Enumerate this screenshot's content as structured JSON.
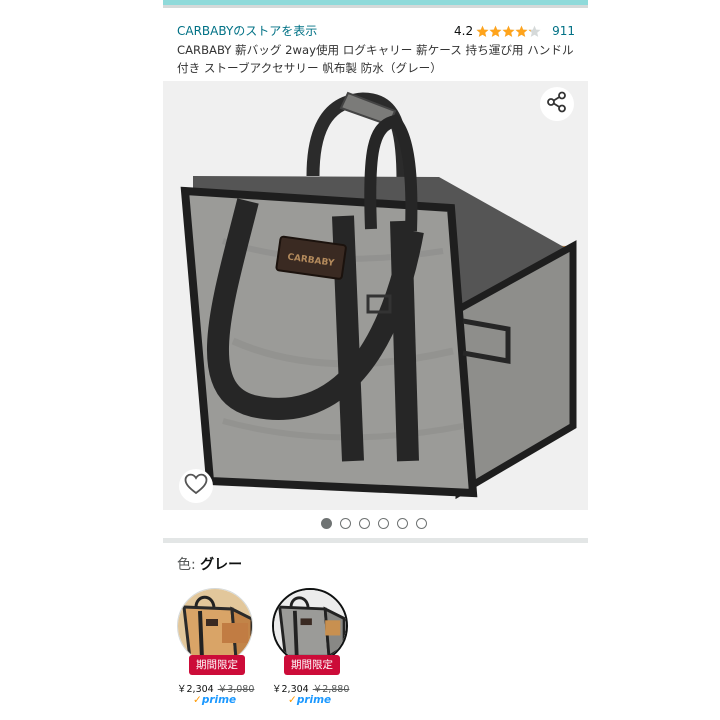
{
  "store": {
    "link_text": "CARBABYのストアを表示",
    "rating": "4.2",
    "stars_filled": 4.2,
    "stars_max": 5,
    "rating_count": "911"
  },
  "product": {
    "title": "CARBABY 薪バッグ 2way使用 ログキャリー 薪ケース 持ち運び用 ハンドル付き ストーブアクセサリー 帆布製 防水（グレー）"
  },
  "gallery": {
    "image_count": 6,
    "active_index": 0,
    "share_icon": "share-icon",
    "wishlist_icon": "heart-icon",
    "brand_patch_text": "CARBABY"
  },
  "variation": {
    "label": "色: ",
    "selected": "グレー",
    "options": [
      {
        "badge": "期間限定",
        "price": "￥2,304",
        "was": "￥3,080",
        "prime": "prime"
      },
      {
        "badge": "期間限定",
        "price": "￥2,304",
        "was": "￥2,880",
        "prime": "prime"
      }
    ]
  },
  "colors": {
    "link": "#007185",
    "star": "#ffa41c",
    "badge": "#cc0c39",
    "prime": "#1a98ff",
    "accent_bar": "#8fdada"
  }
}
